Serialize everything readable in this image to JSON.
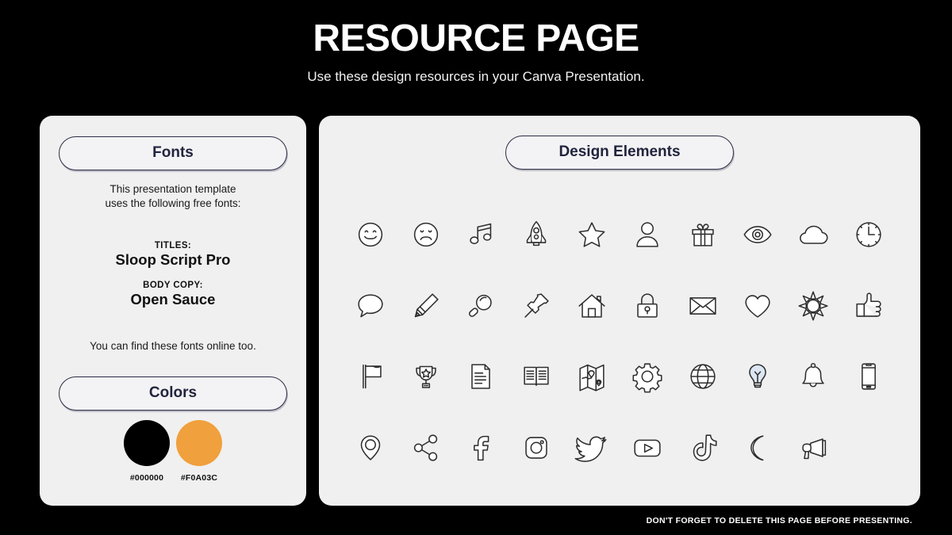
{
  "header": {
    "title": "RESOURCE PAGE",
    "subtitle": "Use these design resources in your Canva Presentation."
  },
  "fonts_panel": {
    "pill_label": "Fonts",
    "intro_line1": "This presentation template",
    "intro_line2": "uses the following free fonts:",
    "titles_label": "TITLES:",
    "titles_font": "Sloop Script Pro",
    "body_label": "BODY COPY:",
    "body_font": "Open Sauce",
    "note": "You can find these fonts online too."
  },
  "colors_section": {
    "pill_label": "Colors",
    "swatches": [
      {
        "hex": "#000000",
        "label": "#000000"
      },
      {
        "hex": "#F0A03C",
        "label": "#F0A03C"
      }
    ]
  },
  "elements_panel": {
    "pill_label": "Design Elements",
    "icons": [
      {
        "name": "smiley-face-icon"
      },
      {
        "name": "sad-face-icon"
      },
      {
        "name": "music-note-icon"
      },
      {
        "name": "rocket-icon"
      },
      {
        "name": "star-icon"
      },
      {
        "name": "person-icon"
      },
      {
        "name": "gift-icon"
      },
      {
        "name": "eye-icon"
      },
      {
        "name": "cloud-icon"
      },
      {
        "name": "clock-icon"
      },
      {
        "name": "speech-bubble-icon"
      },
      {
        "name": "pencil-icon"
      },
      {
        "name": "magnifier-icon"
      },
      {
        "name": "push-pin-icon"
      },
      {
        "name": "house-icon"
      },
      {
        "name": "lock-icon"
      },
      {
        "name": "envelope-icon"
      },
      {
        "name": "heart-icon"
      },
      {
        "name": "sun-icon"
      },
      {
        "name": "thumbs-up-icon"
      },
      {
        "name": "flag-icon"
      },
      {
        "name": "trophy-icon"
      },
      {
        "name": "document-icon"
      },
      {
        "name": "open-book-icon"
      },
      {
        "name": "map-icon"
      },
      {
        "name": "gear-icon"
      },
      {
        "name": "globe-icon"
      },
      {
        "name": "lightbulb-icon"
      },
      {
        "name": "bell-icon"
      },
      {
        "name": "phone-icon"
      },
      {
        "name": "location-pin-icon"
      },
      {
        "name": "share-icon"
      },
      {
        "name": "facebook-icon"
      },
      {
        "name": "instagram-icon"
      },
      {
        "name": "twitter-icon"
      },
      {
        "name": "youtube-icon"
      },
      {
        "name": "tiktok-icon"
      },
      {
        "name": "moon-icon"
      },
      {
        "name": "megaphone-icon"
      }
    ]
  },
  "footer": {
    "note": "DON'T FORGET TO DELETE THIS PAGE BEFORE PRESENTING."
  }
}
